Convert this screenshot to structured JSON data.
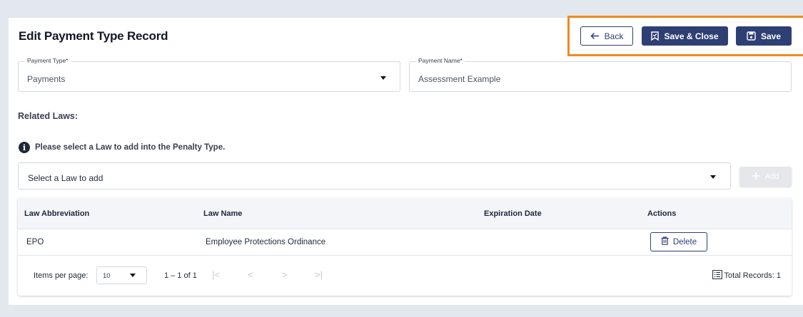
{
  "page": {
    "title": "Edit Payment Type Record"
  },
  "toolbar": {
    "back_label": "Back",
    "save_close_label": "Save & Close",
    "save_label": "Save"
  },
  "form": {
    "payment_type": {
      "label": "Payment Type*",
      "value": "Payments"
    },
    "payment_name": {
      "label": "Payment Name*",
      "value": "Assessment Example"
    }
  },
  "related_laws": {
    "heading": "Related Laws:",
    "info": "Please select a Law to add into the Penalty Type.",
    "select_placeholder": "Select a Law to add",
    "add_label": "Add"
  },
  "table": {
    "columns": [
      "Law Abbreviation",
      "Law Name",
      "Expiration Date",
      "Actions"
    ],
    "rows": [
      {
        "abbreviation": "EPO",
        "name": "Employee Protections Ordinance",
        "expiration": "",
        "action_label": "Delete"
      }
    ]
  },
  "paginator": {
    "items_per_page_label": "Items per page:",
    "items_per_page_value": "10",
    "range": "1 – 1 of 1",
    "total_records": "Total Records: 1"
  },
  "colors": {
    "primary": "#2e3f73",
    "highlight": "#f28a1e",
    "background": "#e3e8ef"
  }
}
